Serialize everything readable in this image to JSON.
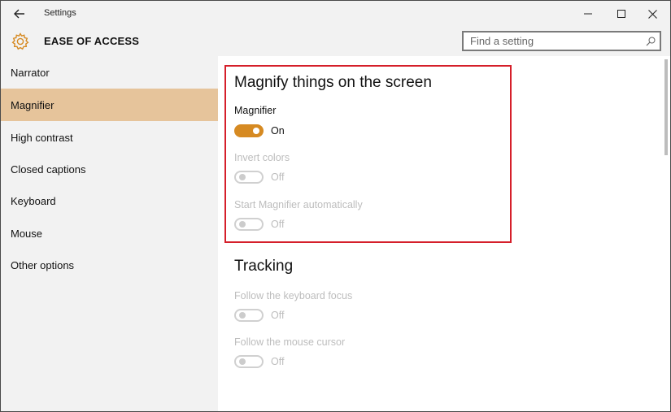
{
  "window": {
    "title": "Settings"
  },
  "header": {
    "section_title": "EASE OF ACCESS",
    "search_placeholder": "Find a setting"
  },
  "sidebar": {
    "items": [
      {
        "label": "Narrator"
      },
      {
        "label": "Magnifier",
        "selected": true
      },
      {
        "label": "High contrast"
      },
      {
        "label": "Closed captions"
      },
      {
        "label": "Keyboard"
      },
      {
        "label": "Mouse"
      },
      {
        "label": "Other options"
      }
    ]
  },
  "main": {
    "magnify": {
      "heading": "Magnify things on the screen",
      "magnifier_label": "Magnifier",
      "magnifier_state": "On",
      "invert_label": "Invert colors",
      "invert_state": "Off",
      "auto_label": "Start Magnifier automatically",
      "auto_state": "Off"
    },
    "tracking": {
      "heading": "Tracking",
      "keyboard_label": "Follow the keyboard focus",
      "keyboard_state": "Off",
      "mouse_label": "Follow the mouse cursor",
      "mouse_state": "Off"
    }
  },
  "colors": {
    "accent": "#d68a22",
    "selected_nav": "#e6c49b",
    "highlight_border": "#d51f2a"
  }
}
